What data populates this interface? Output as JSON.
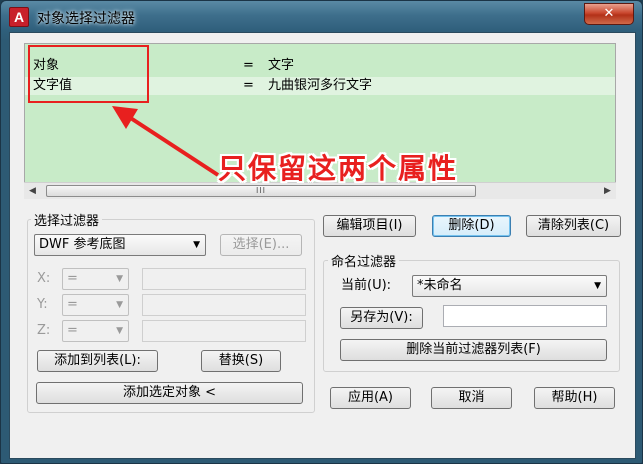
{
  "window": {
    "logo": "A",
    "title": "对象选择过滤器",
    "close_symbol": "✕"
  },
  "list": {
    "rows": [
      {
        "prop": "对象",
        "eq": "=",
        "val": "文字"
      },
      {
        "prop": "文字值",
        "eq": "=",
        "val": "九曲银河多行文字"
      }
    ],
    "scroll_left": "◀",
    "scroll_right": "▶",
    "scroll_grip": "III"
  },
  "annotation": {
    "text": "只保留这两个属性"
  },
  "select_filter": {
    "group_label": "选择过滤器",
    "type_value": "DWF 参考底图",
    "select_button": "选择(E)...",
    "x_label": "X:",
    "y_label": "Y:",
    "z_label": "Z:",
    "op_value": "=",
    "add_to_list": "添加到列表(L):",
    "substitute": "替换(S)",
    "add_selected": "添加选定对象 <"
  },
  "list_buttons": {
    "edit_item": "编辑项目(I)",
    "delete": "删除(D)",
    "clear_list": "清除列表(C)"
  },
  "named_filters": {
    "group_label": "命名过滤器",
    "current_label": "当前(U):",
    "current_value": "*未命名",
    "save_as": "另存为(V):",
    "save_as_value": "",
    "delete_current": "删除当前过滤器列表(F)"
  },
  "footer": {
    "apply": "应用(A)",
    "cancel": "取消",
    "help": "帮助(H)"
  },
  "colors": {
    "list_bg": "#c8ebc8",
    "annotation": "#e8201f",
    "title_bar": "#3e6f8c"
  }
}
